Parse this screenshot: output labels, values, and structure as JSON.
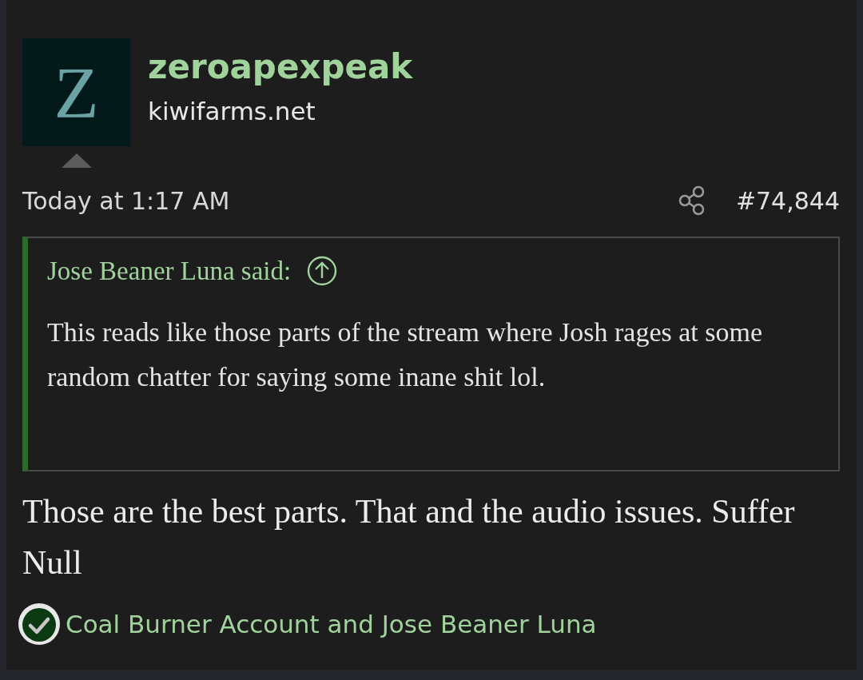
{
  "post": {
    "avatar_letter": "Z",
    "username": "zeroapexpeak",
    "site": "kiwifarms.net",
    "date": "Today at 1:17 AM",
    "number": "#74,844",
    "quote": {
      "attribution": "Jose Beaner Luna said:",
      "text": "This reads like those parts of the stream where Josh rages at some random chatter for saying some inane shit lol."
    },
    "body": "Those are the best parts. That and the audio issues. Suffer Null",
    "reactions": "Coal Burner Account and Jose Beaner Luna"
  }
}
